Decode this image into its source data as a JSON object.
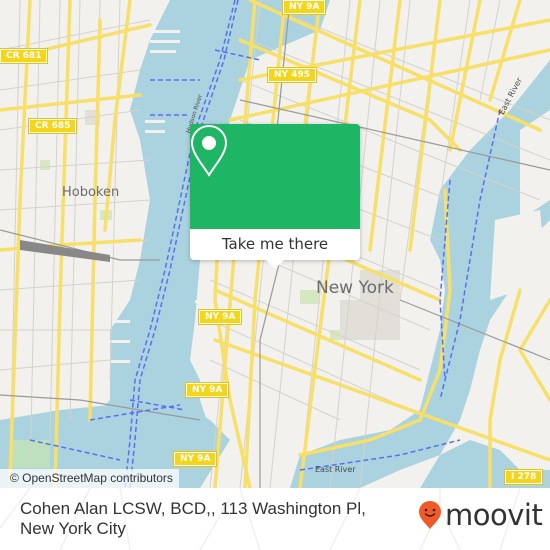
{
  "map": {
    "popup": {
      "icon": "location-pin-icon",
      "button_label": "Take me there",
      "accent_color": "#1eb565"
    },
    "place_labels": {
      "new_york": "New York",
      "hoboken": "Hoboken"
    },
    "water_labels": {
      "east_river_top": "East River",
      "east_river_bottom": "East River",
      "hudson_river": "Hudson River"
    },
    "road_shields": [
      {
        "label": "NY 9A"
      },
      {
        "label": "CR 681"
      },
      {
        "label": "NY 495"
      },
      {
        "label": "CR 685"
      },
      {
        "label": "NY 9A"
      },
      {
        "label": "NY 9A"
      },
      {
        "label": "NY 9A"
      },
      {
        "label": "I 278"
      }
    ],
    "attribution": "© OpenStreetMap contributors"
  },
  "footer": {
    "title": "Cohen Alan LCSW, BCD,, 113 Washington Pl, New York City",
    "brand": {
      "name": "moovit",
      "logo_icon": "moovit-smiley-pin-icon",
      "logo_color": "#f05a28"
    }
  }
}
